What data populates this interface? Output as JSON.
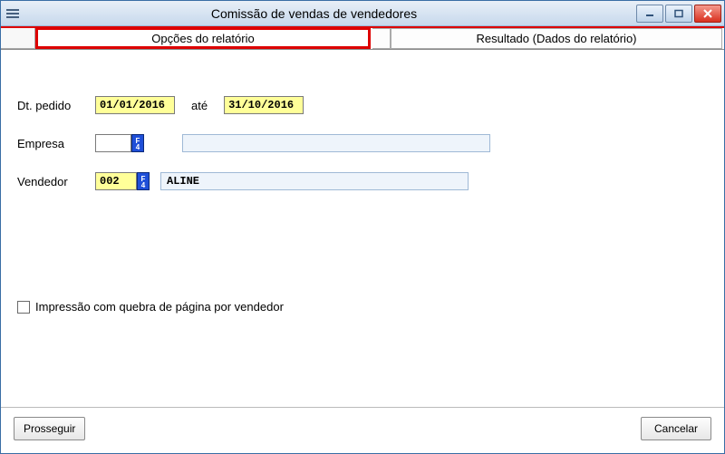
{
  "window": {
    "title": "Comissão de vendas de vendedores"
  },
  "tabs": {
    "options": "Opções do relatório",
    "result": "Resultado (Dados do relatório)"
  },
  "form": {
    "dtpedido_label": "Dt. pedido",
    "dt_from": "01/01/2016",
    "ate_label": "até",
    "dt_to": "31/10/2016",
    "empresa_label": "Empresa",
    "empresa_code": "",
    "empresa_desc": "",
    "vendedor_label": "Vendedor",
    "vendedor_code": "002",
    "vendedor_desc": "ALINE"
  },
  "checkbox": {
    "label": "Impressão com quebra de página por vendedor",
    "checked": false
  },
  "buttons": {
    "proceed": "Prosseguir",
    "cancel": "Cancelar"
  }
}
